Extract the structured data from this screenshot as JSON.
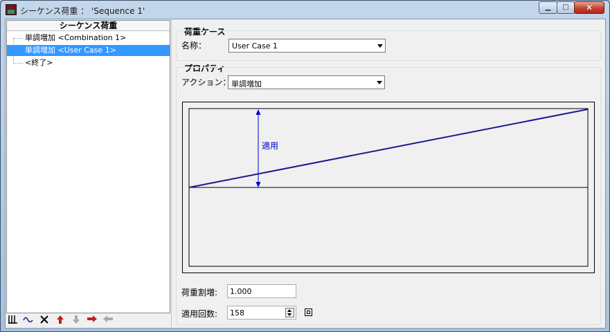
{
  "window": {
    "title": "シーケンス荷重 ： 'Sequence 1'",
    "min_glyph": "▁",
    "max_glyph": "□",
    "close_glyph": "✕"
  },
  "tree": {
    "header": "シーケンス荷重",
    "items": [
      {
        "label": "単調増加 <Combination 1>",
        "selected": false
      },
      {
        "label": "単調増加 <User Case 1>",
        "selected": true
      },
      {
        "label": "<終了>",
        "selected": false
      }
    ]
  },
  "left_toolbar": {
    "icons": [
      "bars-icon",
      "wave-icon",
      "delete-icon",
      "move-up-icon",
      "move-down-icon",
      "arrow-right-icon",
      "arrow-left-icon"
    ]
  },
  "load_case": {
    "group_title": "荷重ケース",
    "name_label": "名称：",
    "name_value": "User Case 1"
  },
  "properties": {
    "group_title": "プロパティ",
    "action_label": "アクション：",
    "action_value": "単調増加",
    "diagram_label": "適用"
  },
  "fields": {
    "increment_label": "荷重割増:",
    "increment_value": "1.000",
    "count_label": "適用回数:",
    "count_value": "158"
  },
  "colors": {
    "selection": "#3399ff",
    "diagram_line": "#1a1a8c",
    "diagram_arrow": "#0000cc",
    "close_red": "#c2432d"
  }
}
